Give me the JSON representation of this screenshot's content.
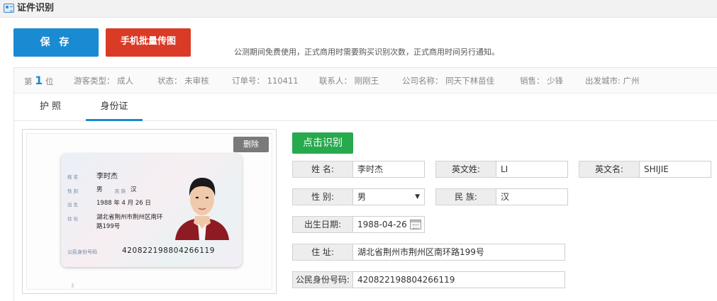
{
  "window": {
    "title": "证件识别",
    "icon": "id-card-icon"
  },
  "toolbar": {
    "save_label": "保 存",
    "upload_label": "手机批量传图",
    "notice": "公测期间免费使用，正式商用时需要购买识别次数，正式商用时间另行通知。"
  },
  "info": {
    "rank_prefix": "第",
    "rank_number": "1",
    "rank_suffix": "位",
    "tourist_type": "游客类型： 成人",
    "status": "状态： 未审核",
    "order_no": "订单号： 110411",
    "contact": "联系人： 刚刚王",
    "company": "公司名称： 同天下林苗佳",
    "sales": "销售： 少锋",
    "departure": "出发城市: 广州"
  },
  "tabs": [
    {
      "label": "护 照",
      "active": false
    },
    {
      "label": "身份证",
      "active": true
    }
  ],
  "photo": {
    "delete_label": "删除",
    "card": {
      "name_label": "姓 名",
      "name": "李时杰",
      "gender_label": "性 别",
      "gender": "男",
      "ethnicity_label": "民 族",
      "ethnicity": "汉",
      "birth_label": "出 生",
      "birth": "1988 年  4 月 26 日",
      "address_label": "住 址",
      "address_line1": "湖北省荆州市荆州区南环",
      "address_line2": "路199号",
      "id_label": "公民身份号码",
      "id_number": "420822198804266119"
    }
  },
  "form": {
    "recognize_label": "点击识别",
    "name_label": "姓 名:",
    "name_value": "李时杰",
    "surname_en_label": "英文姓:",
    "surname_en_value": "LI",
    "given_en_label": "英文名:",
    "given_en_value": "SHIJIE",
    "gender_label": "性 别:",
    "gender_value": "男",
    "ethnicity_label": "民 族:",
    "ethnicity_value": "汉",
    "birth_label": "出生日期:",
    "birth_value": "1988-04-26",
    "address_label": "住 址:",
    "address_value": "湖北省荆州市荆州区南环路199号",
    "id_label": "公民身份号码:",
    "id_value": "420822198804266119"
  },
  "colors": {
    "save_button": "#1a8ad3",
    "upload_button": "#d93b27",
    "recognize_button": "#27a94e",
    "delete_button": "#7a7a7a",
    "tab_active": "#1a8ad3"
  }
}
